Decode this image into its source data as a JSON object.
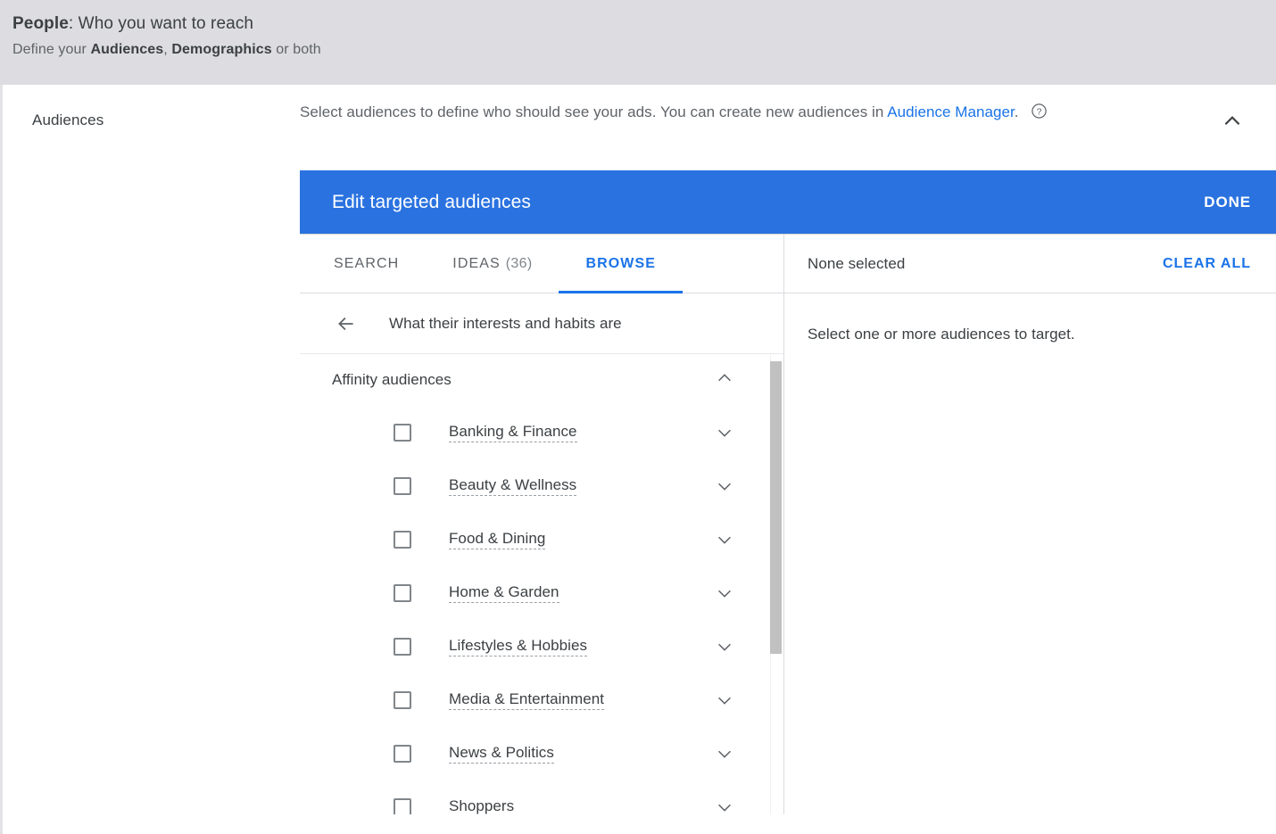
{
  "page_header": {
    "title_strong": "People",
    "title_rest": ": Who you want to reach",
    "subtitle_prefix": "Define your ",
    "subtitle_b1": "Audiences",
    "subtitle_mid": ", ",
    "subtitle_b2": "Demographics",
    "subtitle_suffix": " or both"
  },
  "section": {
    "label": "Audiences",
    "description_part1": "Select audiences to define who should see your ads.  You can create new audiences in ",
    "description_link": "Audience Manager",
    "description_part2": ".",
    "help_icon": "help-circle-icon",
    "collapse_icon": "chevron-up-icon"
  },
  "editor": {
    "title": "Edit targeted audiences",
    "done_label": "DONE",
    "tabs": [
      {
        "label": "SEARCH",
        "count": "",
        "active": false
      },
      {
        "label": "IDEAS",
        "count": "(36)",
        "active": false
      },
      {
        "label": "BROWSE",
        "count": "",
        "active": true
      }
    ],
    "breadcrumb": {
      "back_icon": "arrow-left-icon",
      "text": "What their interests and habits are"
    },
    "group": {
      "label": "Affinity audiences",
      "expanded": true,
      "toggle_icon": "chevron-up-icon"
    },
    "items": [
      {
        "label": "Banking & Finance",
        "checked": false,
        "expand_icon": "chevron-down-icon"
      },
      {
        "label": "Beauty & Wellness",
        "checked": false,
        "expand_icon": "chevron-down-icon"
      },
      {
        "label": "Food & Dining",
        "checked": false,
        "expand_icon": "chevron-down-icon"
      },
      {
        "label": "Home & Garden",
        "checked": false,
        "expand_icon": "chevron-down-icon"
      },
      {
        "label": "Lifestyles & Hobbies",
        "checked": false,
        "expand_icon": "chevron-down-icon"
      },
      {
        "label": "Media & Entertainment",
        "checked": false,
        "expand_icon": "chevron-down-icon"
      },
      {
        "label": "News & Politics",
        "checked": false,
        "expand_icon": "chevron-down-icon"
      },
      {
        "label": "Shoppers",
        "checked": false,
        "expand_icon": "chevron-down-icon"
      }
    ],
    "selected_panel": {
      "status": "None selected",
      "clear_all": "CLEAR ALL",
      "empty_message": "Select one or more audiences to target."
    }
  },
  "colors": {
    "accent_blue": "#1a73e8",
    "bar_blue": "#2a72e0",
    "header_grey": "#dcdce1",
    "text_primary": "#3c4043",
    "text_secondary": "#5f6368"
  }
}
